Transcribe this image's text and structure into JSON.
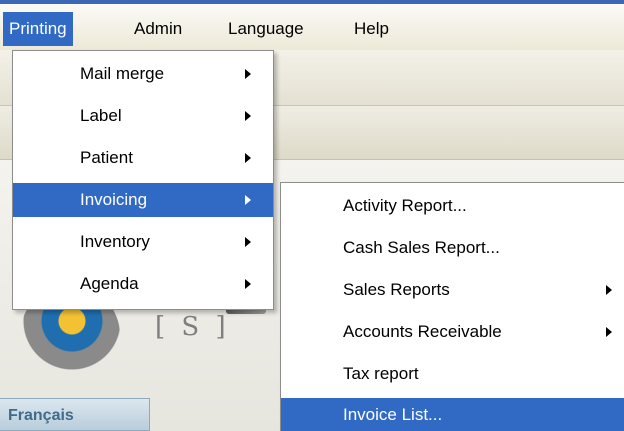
{
  "menubar": {
    "items": [
      {
        "label": "Printing",
        "active": true
      },
      {
        "label": "Admin"
      },
      {
        "label": "Language"
      },
      {
        "label": "Help"
      }
    ]
  },
  "printing_menu": {
    "items": [
      {
        "label": "Mail merge",
        "submenu": true
      },
      {
        "label": "Label",
        "submenu": true
      },
      {
        "label": "Patient",
        "submenu": true
      },
      {
        "label": "Invoicing",
        "submenu": true,
        "highlighted": true
      },
      {
        "label": "Inventory",
        "submenu": true
      },
      {
        "label": "Agenda",
        "submenu": true
      }
    ]
  },
  "invoicing_menu": {
    "items": [
      {
        "label": "Activity Report...",
        "submenu": false
      },
      {
        "label": "Cash Sales Report...",
        "submenu": false
      },
      {
        "label": "Sales Reports",
        "submenu": true
      },
      {
        "label": "Accounts Receivable",
        "submenu": true
      },
      {
        "label": "Tax report",
        "submenu": false
      },
      {
        "label": "Invoice List...",
        "submenu": false,
        "highlighted": true
      }
    ]
  },
  "language_tab": {
    "label": "Français"
  },
  "logo": {
    "mark_text": "[ S ]"
  },
  "colors": {
    "highlight": "#316ac5",
    "menubar_top": "#3c66b6",
    "menu_bg": "#ffffff",
    "lang_text": "#3e6c8a"
  }
}
